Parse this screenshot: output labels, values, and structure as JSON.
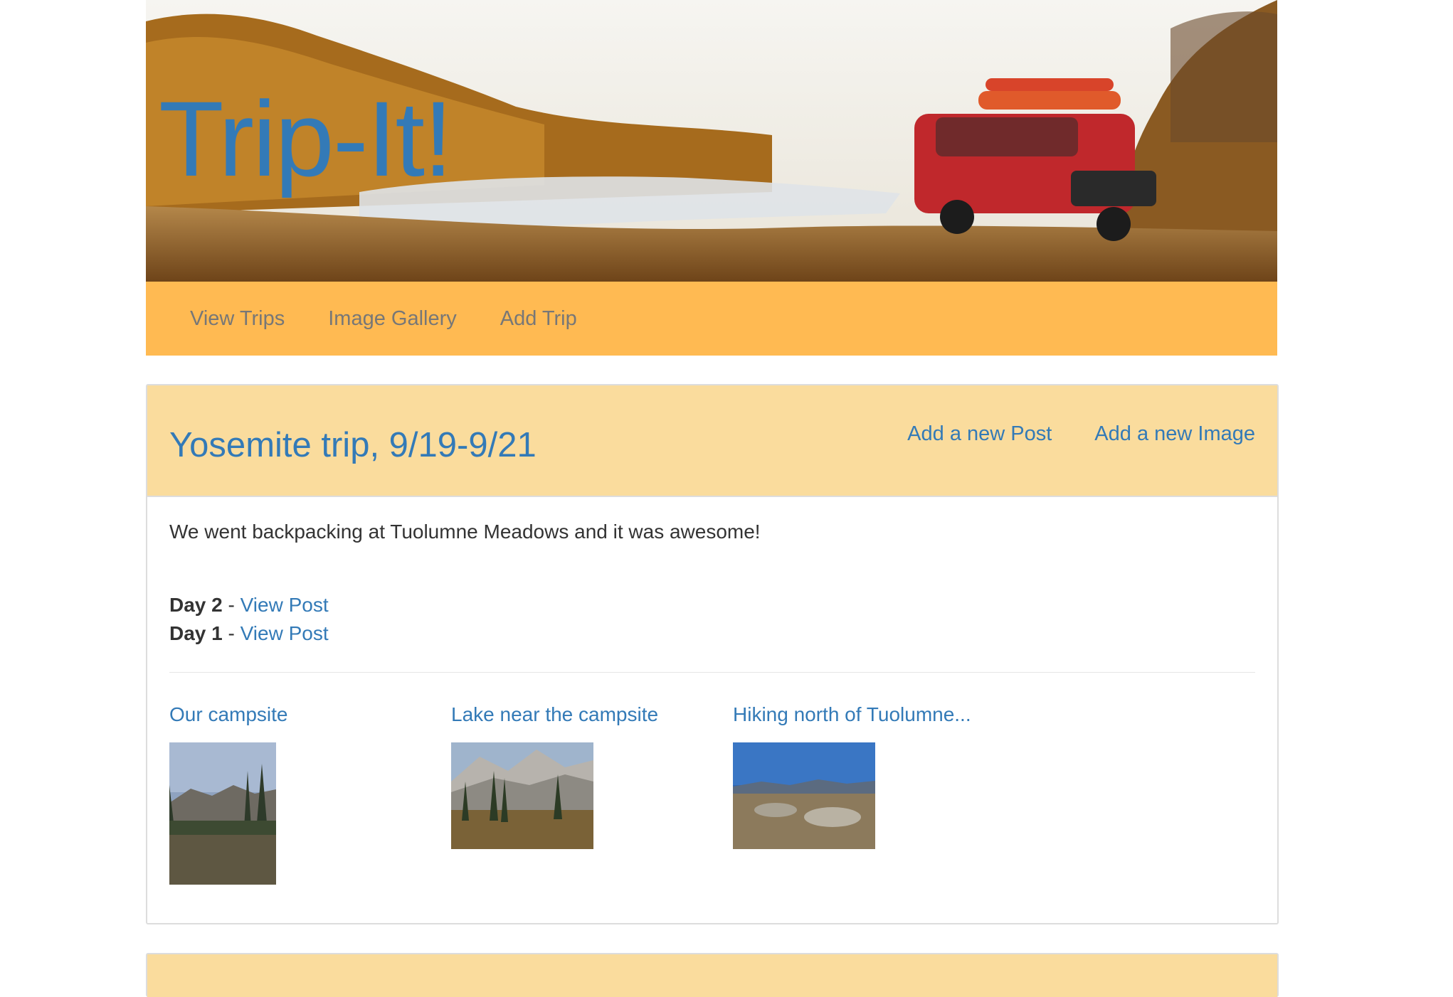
{
  "site": {
    "title": "Trip-It!"
  },
  "nav": {
    "items": [
      {
        "label": "View Trips"
      },
      {
        "label": "Image Gallery"
      },
      {
        "label": "Add Trip"
      }
    ]
  },
  "trip": {
    "title": "Yosemite trip, 9/19-9/21",
    "actions": {
      "add_post": "Add a new Post",
      "add_image": "Add a new Image"
    },
    "description": "We went backpacking at Tuolumne Meadows and it was awesome!",
    "posts": [
      {
        "day": "Day 2",
        "separator": " - ",
        "link": "View Post"
      },
      {
        "day": "Day 1",
        "separator": " - ",
        "link": "View Post"
      }
    ],
    "gallery": [
      {
        "caption": "Our campsite"
      },
      {
        "caption": "Lake near the campsite"
      },
      {
        "caption": "Hiking north of Tuolumne..."
      }
    ]
  },
  "colors": {
    "accent_link": "#337ab7",
    "navbar": "#ffba52",
    "panel_heading": "#fadc9d",
    "nav_text": "#777777"
  }
}
